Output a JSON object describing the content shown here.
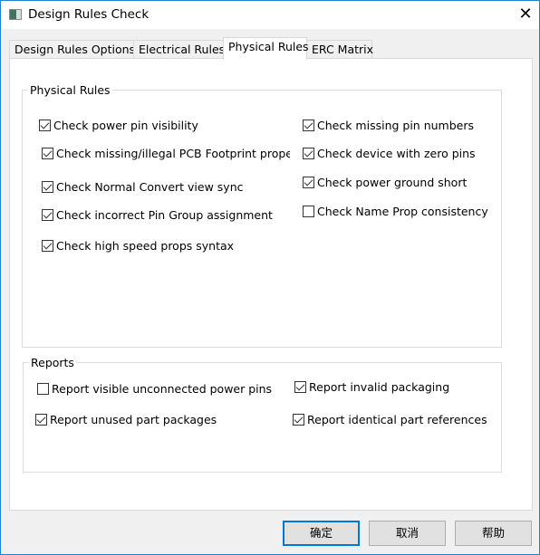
{
  "window": {
    "title": "Design Rules Check",
    "close_icon": "close-icon",
    "app_icon": "app-icon"
  },
  "tabs": [
    {
      "label": "Design Rules Options",
      "selected": false
    },
    {
      "label": "Electrical Rules",
      "selected": false
    },
    {
      "label": "Physical Rules",
      "selected": true
    },
    {
      "label": "ERC Matrix",
      "selected": false
    }
  ],
  "physical_rules": {
    "title": "Physical Rules",
    "items": [
      {
        "label": "Check power pin visibility",
        "checked": true
      },
      {
        "label": "Check missing/illegal PCB Footprint property",
        "checked": true
      },
      {
        "label": "Check Normal Convert view sync",
        "checked": true
      },
      {
        "label": "Check incorrect Pin Group assignment",
        "checked": true
      },
      {
        "label": "Check high speed props syntax",
        "checked": true
      },
      {
        "label": "Check missing pin numbers",
        "checked": true
      },
      {
        "label": "Check device with zero pins",
        "checked": true
      },
      {
        "label": "Check power ground short",
        "checked": true
      },
      {
        "label": "Check Name Prop consistency",
        "checked": false
      }
    ]
  },
  "reports": {
    "title": "Reports",
    "items": [
      {
        "label": "Report visible unconnected power pins",
        "checked": false
      },
      {
        "label": "Report invalid packaging",
        "checked": true
      },
      {
        "label": "Report unused part packages",
        "checked": true
      },
      {
        "label": "Report identical part references",
        "checked": true
      }
    ]
  },
  "buttons": {
    "ok": "确定",
    "cancel": "取消",
    "help": "帮助"
  }
}
